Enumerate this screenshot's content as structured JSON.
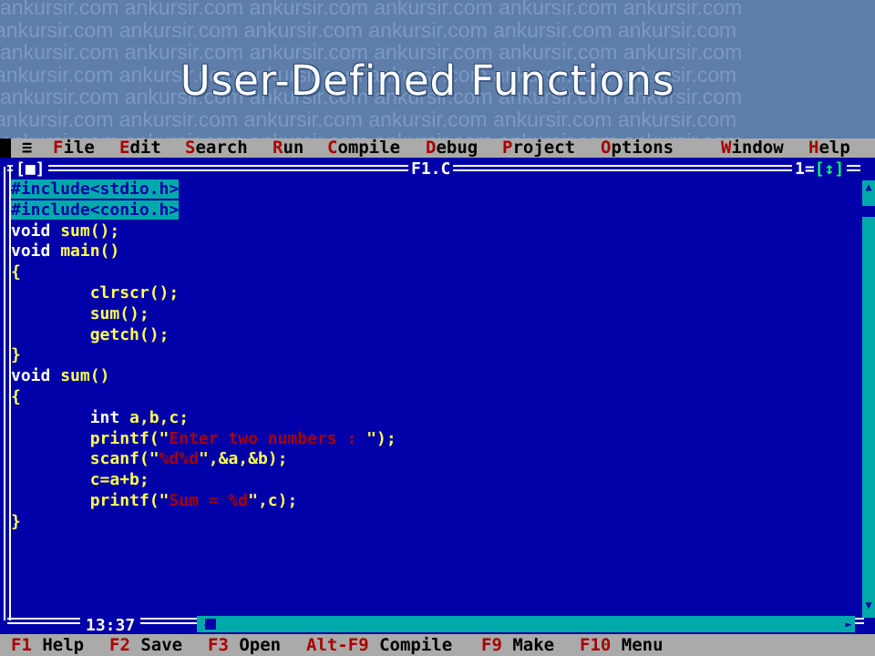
{
  "slide": {
    "title": "User-Defined Functions",
    "watermark": "ankursir.com"
  },
  "menu": {
    "system": "≡",
    "items": [
      {
        "hotkey": "F",
        "rest": "ile"
      },
      {
        "hotkey": "E",
        "rest": "dit"
      },
      {
        "hotkey": "S",
        "rest": "earch"
      },
      {
        "hotkey": "R",
        "rest": "un"
      },
      {
        "hotkey": "C",
        "rest": "ompile"
      },
      {
        "hotkey": "D",
        "rest": "ebug"
      },
      {
        "hotkey": "P",
        "rest": "roject"
      },
      {
        "hotkey": "O",
        "rest": "ptions"
      },
      {
        "hotkey": "W",
        "rest": "indow"
      },
      {
        "hotkey": "H",
        "rest": "elp"
      }
    ]
  },
  "editor": {
    "filename": "F1.C",
    "close_box": "[■]",
    "window_number": "1",
    "zoom_box": "[↕]",
    "cursor_position": "13:37",
    "lines": [
      [
        {
          "t": "#include<stdio.h>",
          "c": "sel"
        }
      ],
      [
        {
          "t": "#include<conio.h>",
          "c": "sel"
        }
      ],
      [
        {
          "t": "void ",
          "c": "kw"
        },
        {
          "t": "sum",
          "c": "fn"
        },
        {
          "t": "();",
          "c": "pn"
        }
      ],
      [
        {
          "t": "void ",
          "c": "kw"
        },
        {
          "t": "main",
          "c": "fn"
        },
        {
          "t": "()",
          "c": "pn"
        }
      ],
      [
        {
          "t": "{",
          "c": "br"
        }
      ],
      [
        {
          "t": "        clrscr",
          "c": "fn"
        },
        {
          "t": "();",
          "c": "pn"
        }
      ],
      [
        {
          "t": "        sum",
          "c": "fn"
        },
        {
          "t": "();",
          "c": "pn"
        }
      ],
      [
        {
          "t": "        getch",
          "c": "fn"
        },
        {
          "t": "();",
          "c": "pn"
        }
      ],
      [
        {
          "t": "}",
          "c": "br"
        }
      ],
      [
        {
          "t": "void ",
          "c": "kw"
        },
        {
          "t": "sum",
          "c": "fn"
        },
        {
          "t": "()",
          "c": "pn"
        }
      ],
      [
        {
          "t": "{",
          "c": "br"
        }
      ],
      [
        {
          "t": "        int ",
          "c": "kw"
        },
        {
          "t": "a,b,c;",
          "c": "fn"
        }
      ],
      [
        {
          "t": "        printf",
          "c": "fn"
        },
        {
          "t": "(\"",
          "c": "pn"
        },
        {
          "t": "Enter two numbers : ",
          "c": "st"
        },
        {
          "t": "\");",
          "c": "pn"
        }
      ],
      [
        {
          "t": "        scanf",
          "c": "fn"
        },
        {
          "t": "(\"",
          "c": "pn"
        },
        {
          "t": "%d%d",
          "c": "st"
        },
        {
          "t": "\",&a,&b);",
          "c": "pn"
        }
      ],
      [
        {
          "t": "        c=a+b;",
          "c": "fn"
        }
      ],
      [
        {
          "t": "        printf",
          "c": "fn"
        },
        {
          "t": "(\"",
          "c": "pn"
        },
        {
          "t": "Sum = %d",
          "c": "st"
        },
        {
          "t": "\",c);",
          "c": "pn"
        }
      ],
      [
        {
          "t": "}",
          "c": "br"
        }
      ]
    ]
  },
  "status_bar": [
    {
      "key": "F1",
      "label": " Help"
    },
    {
      "key": "F2",
      "label": " Save"
    },
    {
      "key": "F3",
      "label": " Open"
    },
    {
      "key": "Alt-F9",
      "label": " Compile"
    },
    {
      "key": "F9",
      "label": " Make"
    },
    {
      "key": "F10",
      "label": " Menu"
    }
  ],
  "colors": {
    "editor_bg": "#0000a8",
    "menu_bg": "#aaaaaa",
    "hotkey": "#a80000",
    "selection": "#00aaaa",
    "identifier": "#ffff55",
    "string": "#a80000"
  }
}
